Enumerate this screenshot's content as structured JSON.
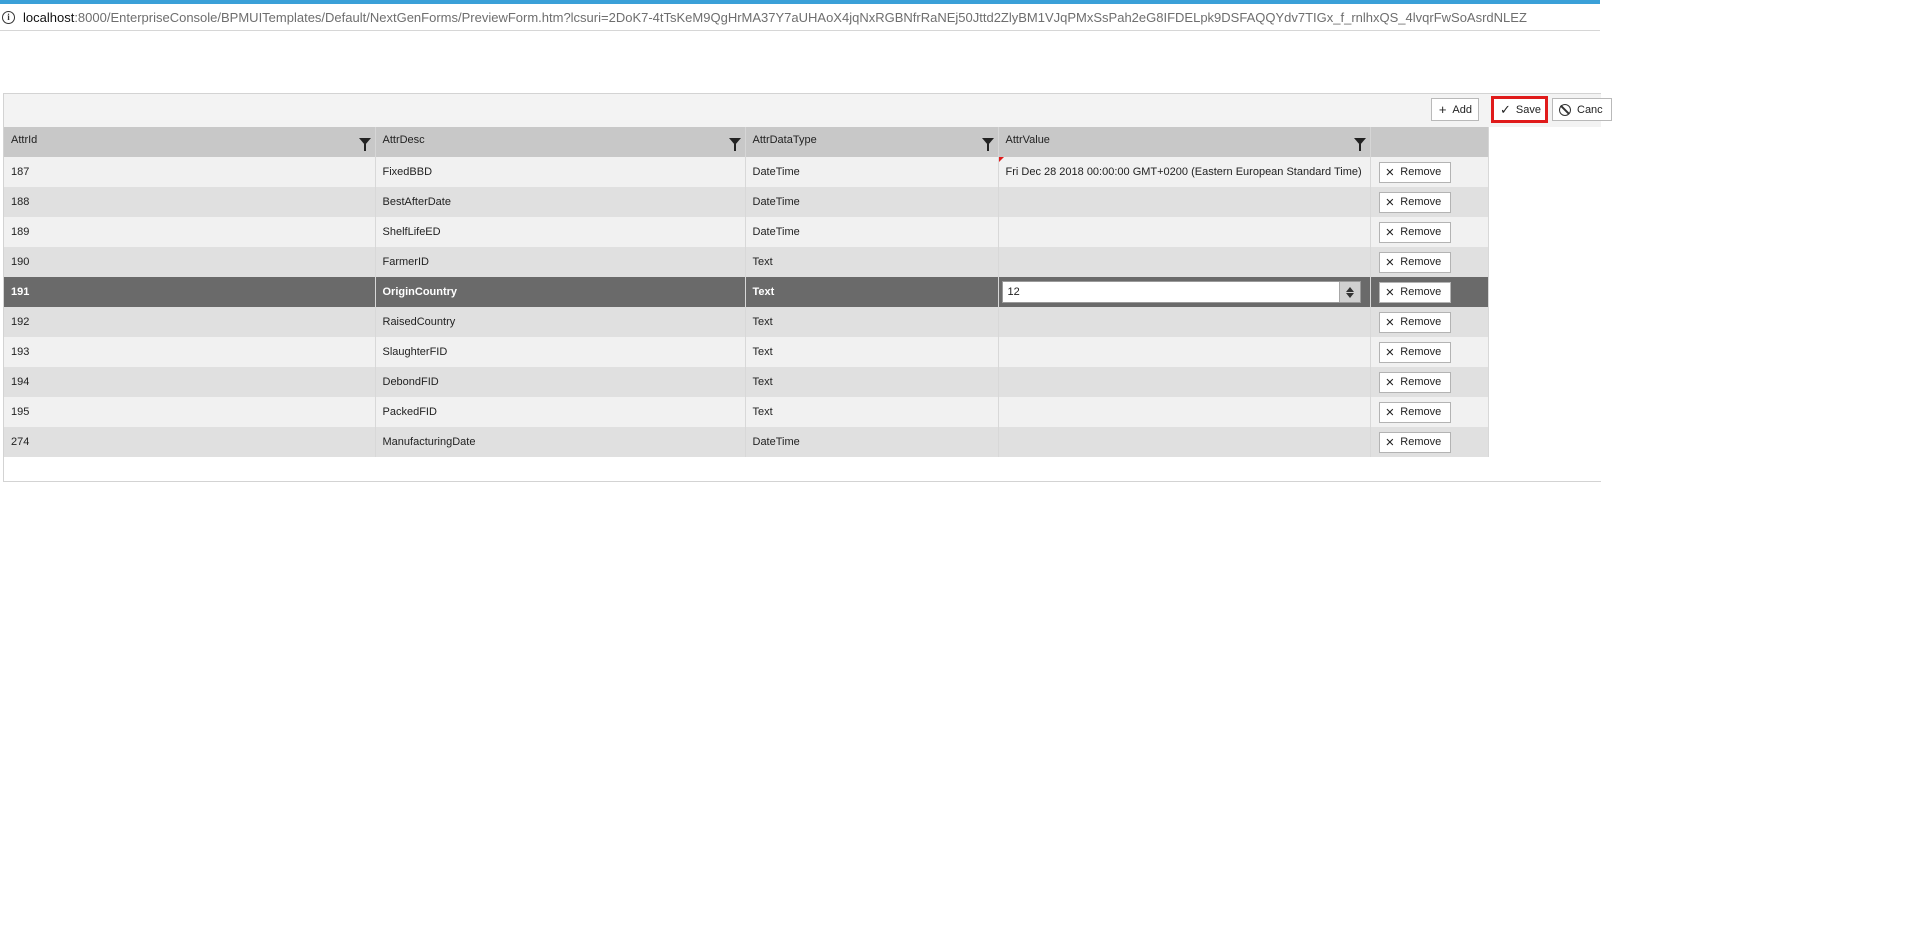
{
  "browser": {
    "url_host": "localhost",
    "url_path": ":8000/EnterpriseConsole/BPMUITemplates/Default/NextGenForms/PreviewForm.htm?lcsuri=2DoK7-4tTsKeM9QgHrMA37Y7aUHAoX4jqNxRGBNfrRaNEj50Jttd2ZlyBM1VJqPMxSsPah2eG8IFDELpk9DSFAQQYdv7TIGx_f_rnlhxQS_4lvqrFwSoAsrdNLEZ"
  },
  "toolbar": {
    "add_label": "Add",
    "save_label": "Save",
    "cancel_label": "Canc"
  },
  "grid": {
    "columns": [
      "AttrId",
      "AttrDesc",
      "AttrDataType",
      "AttrValue"
    ],
    "remove_label": "Remove",
    "selected_index": 4,
    "rows": [
      {
        "id": "187",
        "desc": "FixedBBD",
        "type": "DateTime",
        "value": "Fri Dec 28 2018 00:00:00 GMT+0200 (Eastern European Standard Time)",
        "dirty": true
      },
      {
        "id": "188",
        "desc": "BestAfterDate",
        "type": "DateTime",
        "value": ""
      },
      {
        "id": "189",
        "desc": "ShelfLifeED",
        "type": "DateTime",
        "value": ""
      },
      {
        "id": "190",
        "desc": "FarmerID",
        "type": "Text",
        "value": ""
      },
      {
        "id": "191",
        "desc": "OriginCountry",
        "type": "Text",
        "value": "12",
        "editing": true
      },
      {
        "id": "192",
        "desc": "RaisedCountry",
        "type": "Text",
        "value": ""
      },
      {
        "id": "193",
        "desc": "SlaughterFID",
        "type": "Text",
        "value": ""
      },
      {
        "id": "194",
        "desc": "DebondFID",
        "type": "Text",
        "value": ""
      },
      {
        "id": "195",
        "desc": "PackedFID",
        "type": "Text",
        "value": ""
      },
      {
        "id": "274",
        "desc": "ManufacturingDate",
        "type": "DateTime",
        "value": ""
      }
    ]
  }
}
